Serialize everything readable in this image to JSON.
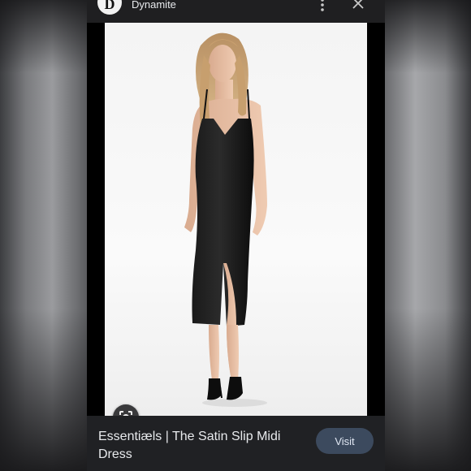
{
  "topbar": {
    "brand_initial": "D",
    "brand_name": "Dynamite"
  },
  "icons": {
    "more": "more-vertical-icon",
    "close": "close-icon",
    "lens": "google-lens-icon"
  },
  "result": {
    "title": "Essentiæls | The Satin Slip Midi Dress",
    "visit_label": "Visit"
  },
  "colors": {
    "topbar_bg": "#1f1f21",
    "bottom_bg": "#202124",
    "visit_bg": "#3c4a5e",
    "text": "#e8eaed"
  }
}
